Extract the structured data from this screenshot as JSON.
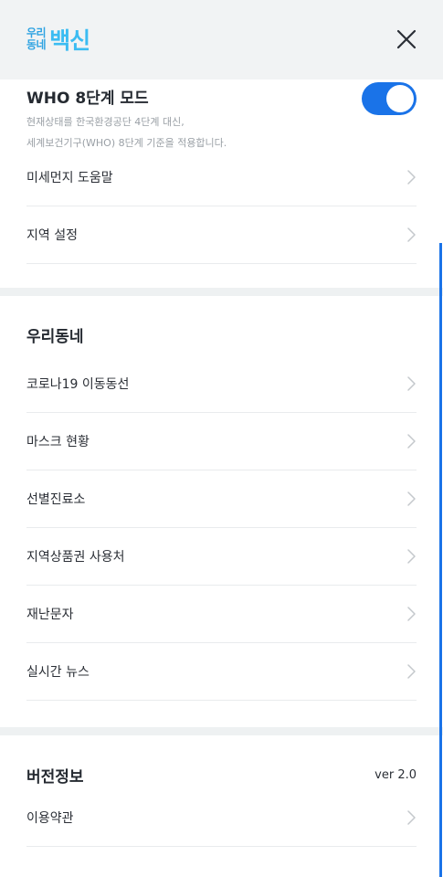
{
  "header": {
    "logo_small_line1": "우리",
    "logo_small_line2": "동네",
    "logo_big": "백신"
  },
  "who_mode": {
    "title": "WHO 8단계 모드",
    "desc_line1": "현재상태를 한국환경공단 4단계 대신,",
    "desc_line2": "세계보건기구(WHO) 8단계 기준을 적용합니다.",
    "enabled": true
  },
  "settings_items": [
    {
      "label": "미세먼지 도움말"
    },
    {
      "label": "지역 설정"
    }
  ],
  "neighborhood": {
    "title": "우리동네",
    "items": [
      {
        "label": "코로나19 이동동선"
      },
      {
        "label": "마스크 현황"
      },
      {
        "label": "선별진료소"
      },
      {
        "label": "지역상품권 사용처"
      },
      {
        "label": "재난문자"
      },
      {
        "label": "실시간 뉴스"
      }
    ]
  },
  "version_info": {
    "title": "버전정보",
    "version": "ver 2.0",
    "items": [
      {
        "label": "이용약관"
      }
    ]
  },
  "colors": {
    "accent": "#1a73e8",
    "logo": "#3bbcf2",
    "header_bg": "#f1f3f4",
    "divider": "#e9ebed"
  }
}
